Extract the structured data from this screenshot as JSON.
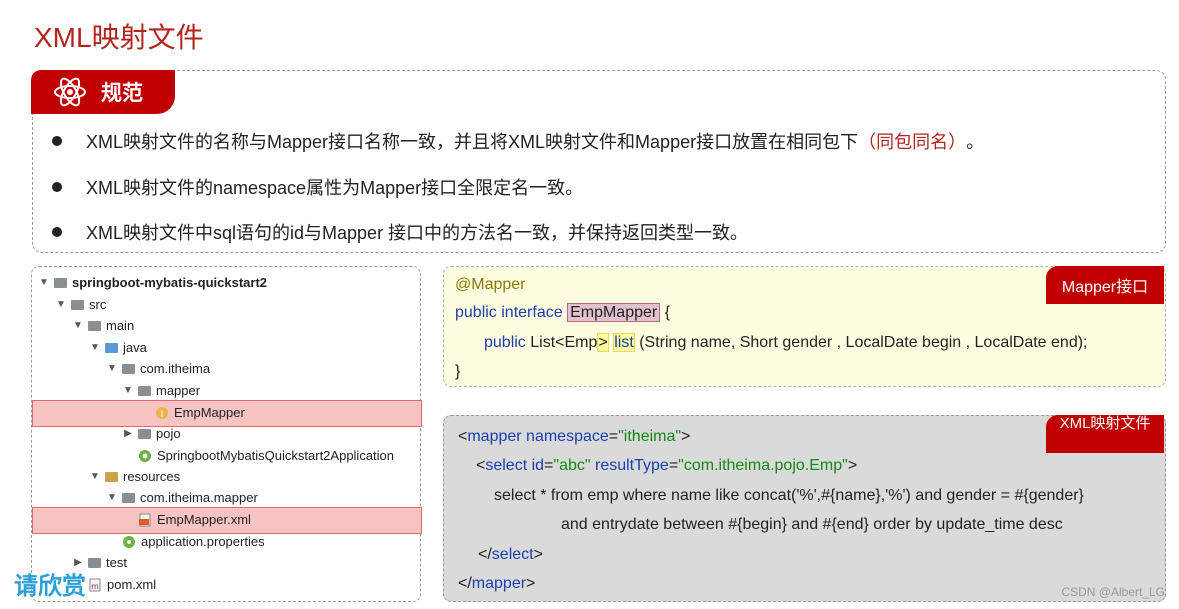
{
  "page_title": "XML映射文件",
  "rules": {
    "tab_label": "规范",
    "bullets": [
      {
        "text": "XML映射文件的名称与Mapper接口名称一致，并且将XML映射文件和Mapper接口放置在相同包下",
        "highlight": "（同包同名）",
        "tail": "。"
      },
      {
        "text": "XML映射文件的namespace属性为Mapper接口全限定名一致。"
      },
      {
        "text": "XML映射文件中sql语句的id与Mapper 接口中的方法名一致，并保持返回类型一致。"
      }
    ]
  },
  "tree": {
    "nodes": [
      {
        "label": "springboot-mybatis-quickstart2",
        "arrow": "down",
        "icon": "project-folder-icon"
      },
      {
        "label": "src",
        "arrow": "down",
        "icon": "folder-icon"
      },
      {
        "label": "main",
        "arrow": "down",
        "icon": "folder-icon"
      },
      {
        "label": "java",
        "arrow": "down",
        "icon": "source-folder-icon"
      },
      {
        "label": "com.itheima",
        "arrow": "down",
        "icon": "package-icon"
      },
      {
        "label": "mapper",
        "arrow": "down",
        "icon": "package-icon"
      },
      {
        "label": "EmpMapper",
        "arrow": "",
        "icon": "interface-icon"
      },
      {
        "label": "pojo",
        "arrow": "right",
        "icon": "package-icon"
      },
      {
        "label": "SpringbootMybatisQuickstart2Application",
        "arrow": "",
        "icon": "spring-boot-icon"
      },
      {
        "label": "resources",
        "arrow": "down",
        "icon": "resources-folder-icon"
      },
      {
        "label": "com.itheima.mapper",
        "arrow": "down",
        "icon": "folder-icon"
      },
      {
        "label": "EmpMapper.xml",
        "arrow": "",
        "icon": "xml-file-icon"
      },
      {
        "label": "application.properties",
        "arrow": "",
        "icon": "properties-file-icon"
      },
      {
        "label": "test",
        "arrow": "right",
        "icon": "folder-icon"
      },
      {
        "label": "pom.xml",
        "arrow": "",
        "icon": "maven-file-icon"
      }
    ]
  },
  "mapper_code": {
    "tag": "Mapper接口",
    "line1": "@Mapper",
    "line2_kw": "public interface",
    "line2_name": "EmpMapper",
    "line2_tail": "{",
    "line3_kw": "public",
    "line3_a": "List<Emp",
    "line3_b": ">",
    "line3_c": "list",
    "line3_d": "(String name, Short gender , LocalDate begin , LocalDate end);",
    "line4": "}"
  },
  "xml_code": {
    "tag": "XML映射文件",
    "l1_a": "<",
    "l1_tag": "mapper",
    "l1_attr": "namespace",
    "l1_eq": "=",
    "l1_val": "\"itheima\"",
    "l1_end": ">",
    "l2_a": "<",
    "l2_tag": "select",
    "l2_attr1": "id",
    "l2_val1": "\"abc\"",
    "l2_attr2": "resultType",
    "l2_val2": "\"com.itheima.pojo.Emp\"",
    "l2_end": ">",
    "l3": "select * from emp where name like concat('%',#{name},'%') and gender = #{gender}",
    "l4": "and entrydate between #{begin} and #{end} order by update_time desc",
    "l5_a": "</",
    "l5_tag": "select",
    "l5_end": ">",
    "l6_a": "</",
    "l6_tag": "mapper",
    "l6_end": ">"
  },
  "watermark": "请欣赏",
  "credit": "CSDN @Albert_LG",
  "colors": {
    "accent_red": "#c00000",
    "title_red": "#b3241f",
    "keyword_blue": "#1a3fb0",
    "string_green": "#128a12"
  }
}
